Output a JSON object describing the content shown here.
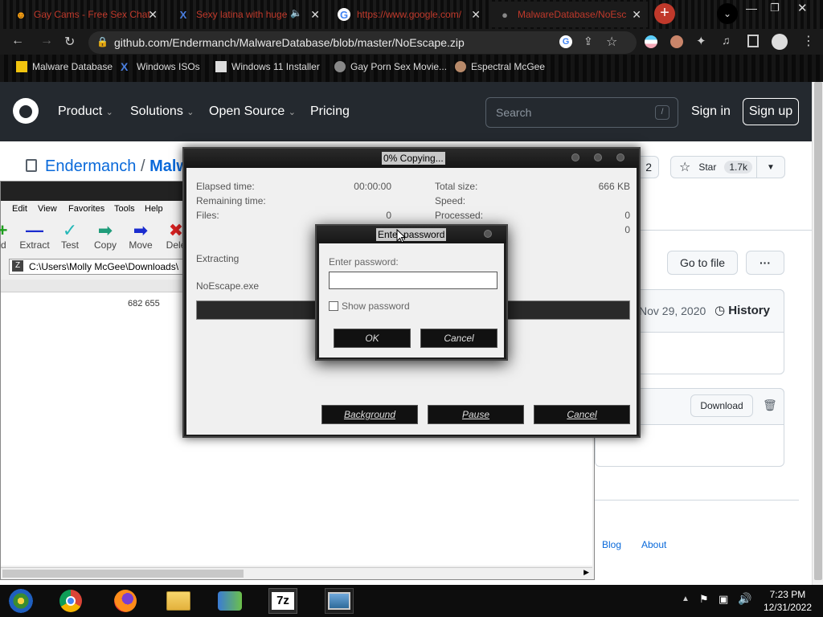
{
  "browser": {
    "tabs": [
      {
        "title": "Gay Cams - Free Sex Chat",
        "icon": "chaturbate-icon"
      },
      {
        "title": "Sexy latina with huge",
        "icon": "x-icon"
      },
      {
        "title": "https://www.google.com/",
        "icon": "google-icon"
      },
      {
        "title": "MalwareDatabase/NoEsc",
        "icon": "github-icon"
      }
    ],
    "url": "github.com/Endermanch/MalwareDatabase/blob/master/NoEscape.zip",
    "bookmarks": [
      "Malware Database",
      "Windows ISOs",
      "Windows 11 Installer",
      "Gay Porn Sex Movie...",
      "Espectral McGee"
    ]
  },
  "github": {
    "nav": [
      "Product",
      "Solutions",
      "Open Source",
      "Pricing"
    ],
    "search_placeholder": "Search",
    "search_key": "/",
    "sign_in": "Sign in",
    "sign_up": "Sign up",
    "repo_owner": "Endermanch",
    "repo_sep": "/",
    "repo_name": "Malw",
    "fork_count": "2",
    "star_label": "Star",
    "star_count": "1.7k",
    "goto_file": "Go to file",
    "more": "···",
    "commit_date": "Nov 29, 2020",
    "history": "History",
    "download": "Download",
    "footer_links": [
      "Blog",
      "About"
    ]
  },
  "sevenzip": {
    "menu": [
      "Edit",
      "View",
      "Favorites",
      "Tools",
      "Help"
    ],
    "tools": [
      "ld",
      "Extract",
      "Test",
      "Copy",
      "Move",
      "Dele"
    ],
    "path": "C:\\Users\\Molly McGee\\Downloads\\",
    "size": "682 655"
  },
  "copy_dialog": {
    "title": "0% Copying...",
    "elapsed_label": "Elapsed time:",
    "elapsed_value": "00:00:00",
    "remaining_label": "Remaining time:",
    "files_label": "Files:",
    "files_value": "0",
    "total_label": "Total size:",
    "total_value": "666 KB",
    "speed_label": "Speed:",
    "processed_label": "Processed:",
    "processed_value": "0",
    "processed_value2": "0",
    "action": "Extracting",
    "filename": "NoEscape.exe",
    "progress": 0,
    "buttons": {
      "background": "Background",
      "pause": "Pause",
      "cancel": "Cancel"
    }
  },
  "password_dialog": {
    "title": "Enter password",
    "label": "Enter password:",
    "value": "",
    "show_password": "Show password",
    "show_checked": false,
    "ok": "OK",
    "cancel": "Cancel"
  },
  "taskbar": {
    "time": "7:23 PM",
    "date": "12/31/2022",
    "icons": [
      "chrome-icon",
      "firefox-icon",
      "file-explorer-icon",
      "network-icon",
      "7zip-icon",
      "photo-icon"
    ]
  }
}
